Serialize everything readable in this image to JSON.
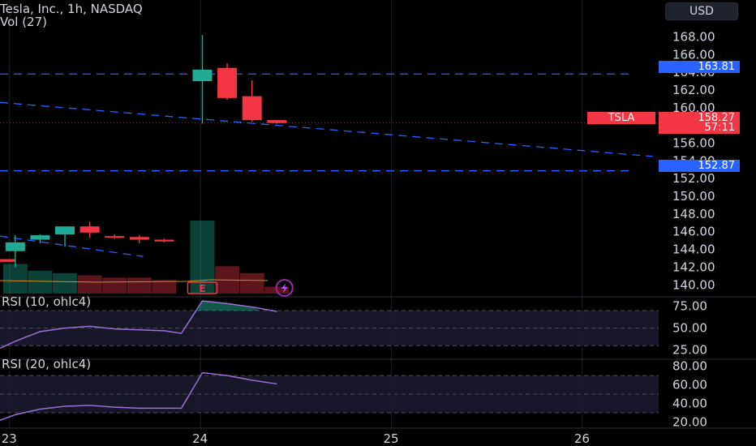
{
  "header": {
    "symbol_line": "Tesla, Inc., 1h, NASDAQ",
    "vol_label": "Vol (27)"
  },
  "currency_button": "USD",
  "ticker_badge": "TSLA",
  "price_labels": {
    "current": "158.27",
    "countdown": "57:11",
    "upper_line": "163.81",
    "lower_line": "152.87"
  },
  "colors": {
    "up": "#22ab94",
    "down": "#f23645",
    "accent_blue": "#2962ff",
    "rsi_line": "#9c6fd6",
    "grid": "#1c1f26"
  },
  "icons": [
    "earnings-icon",
    "lightning-icon"
  ],
  "earnings_marker": "E",
  "chart_data": [
    {
      "type": "candlestick",
      "title": "Tesla, Inc., 1h, NASDAQ",
      "x_ticks": [
        {
          "label": "23",
          "x": 23
        },
        {
          "label": "24",
          "x": 24
        },
        {
          "label": "25",
          "x": 25
        },
        {
          "label": "26",
          "x": 26
        }
      ],
      "xlim": [
        22.95,
        26.4
      ],
      "ylim": [
        139.2,
        169.6
      ],
      "y_ticks": [
        140,
        142,
        144,
        146,
        148,
        150,
        152,
        154,
        156,
        158,
        160,
        162,
        164,
        166,
        168
      ],
      "y_tick_labels": [
        "140.00",
        "142.00",
        "144.00",
        "146.00",
        "148.00",
        "150.00",
        "152.00",
        "154.00",
        "156.00",
        "158.00",
        "160.00",
        "162.00",
        "164.00",
        "166.00",
        "168.00"
      ],
      "candles": [
        {
          "x": 22.98,
          "open": 142.9,
          "high": 142.9,
          "low": 142.6,
          "close": 142.6
        },
        {
          "x": 23.03,
          "open": 143.8,
          "high": 145.6,
          "low": 142.0,
          "close": 144.8
        },
        {
          "x": 23.16,
          "open": 145.1,
          "high": 145.7,
          "low": 144.7,
          "close": 145.6
        },
        {
          "x": 23.29,
          "open": 145.7,
          "high": 146.2,
          "low": 144.3,
          "close": 146.6
        },
        {
          "x": 23.42,
          "open": 146.6,
          "high": 147.1,
          "low": 145.3,
          "close": 145.9
        },
        {
          "x": 23.55,
          "open": 145.5,
          "high": 145.7,
          "low": 145.2,
          "close": 145.4
        },
        {
          "x": 23.68,
          "open": 145.4,
          "high": 145.6,
          "low": 144.7,
          "close": 145.1
        },
        {
          "x": 23.81,
          "open": 145.1,
          "high": 145.2,
          "low": 144.8,
          "close": 144.9
        },
        {
          "x": 24.01,
          "open": 163.0,
          "high": 168.2,
          "low": 158.2,
          "close": 164.3
        },
        {
          "x": 24.14,
          "open": 164.5,
          "high": 165.0,
          "low": 160.9,
          "close": 161.1
        },
        {
          "x": 24.27,
          "open": 161.3,
          "high": 163.1,
          "low": 158.4,
          "close": 158.6
        },
        {
          "x": 24.4,
          "open": 158.6,
          "high": 158.6,
          "low": 158.2,
          "close": 158.27
        }
      ],
      "volume": [
        {
          "x": 23.03,
          "value": 1.3,
          "dir": "up"
        },
        {
          "x": 23.16,
          "value": 1.0,
          "dir": "up"
        },
        {
          "x": 23.29,
          "value": 0.9,
          "dir": "up"
        },
        {
          "x": 23.42,
          "value": 0.8,
          "dir": "down"
        },
        {
          "x": 23.55,
          "value": 0.7,
          "dir": "down"
        },
        {
          "x": 23.68,
          "value": 0.7,
          "dir": "down"
        },
        {
          "x": 23.81,
          "value": 0.6,
          "dir": "down"
        },
        {
          "x": 24.01,
          "value": 3.2,
          "dir": "up"
        },
        {
          "x": 24.14,
          "value": 1.2,
          "dir": "down"
        },
        {
          "x": 24.27,
          "value": 0.9,
          "dir": "down"
        },
        {
          "x": 24.4,
          "value": 0.3,
          "dir": "down"
        }
      ],
      "horizontal_lines": [
        163.81,
        152.87
      ],
      "trend_lines": [
        {
          "points": [
            [
              22.95,
              160.6
            ],
            [
              26.37,
              154.5
            ]
          ]
        },
        {
          "points": [
            [
              22.95,
              145.5
            ],
            [
              23.7,
              143.2
            ]
          ]
        }
      ],
      "current_price": 158.27
    },
    {
      "type": "line",
      "title": "RSI (10, ohlc4)",
      "ylim": [
        20,
        82
      ],
      "y_ticks": [
        25,
        50,
        75
      ],
      "y_tick_labels": [
        "25.00",
        "50.00",
        "75.00"
      ],
      "band": [
        30,
        70
      ],
      "x": [
        22.95,
        23.03,
        23.16,
        23.29,
        23.42,
        23.55,
        23.68,
        23.81,
        23.9,
        24.01,
        24.14,
        24.27,
        24.4
      ],
      "values": [
        27,
        35,
        46,
        50,
        52,
        49,
        48,
        47,
        44,
        81,
        78,
        74,
        69
      ]
    },
    {
      "type": "line",
      "title": "RSI (20, ohlc4)",
      "ylim": [
        17,
        84
      ],
      "y_ticks": [
        20,
        40,
        60,
        80
      ],
      "y_tick_labels": [
        "20.00",
        "40.00",
        "60.00",
        "80.00"
      ],
      "band": [
        30,
        70
      ],
      "x": [
        22.95,
        23.03,
        23.16,
        23.29,
        23.42,
        23.55,
        23.68,
        23.81,
        23.9,
        24.01,
        24.14,
        24.27,
        24.4
      ],
      "values": [
        22,
        28,
        34,
        37,
        38,
        36,
        35,
        35,
        35,
        73,
        70,
        65,
        61
      ]
    }
  ]
}
